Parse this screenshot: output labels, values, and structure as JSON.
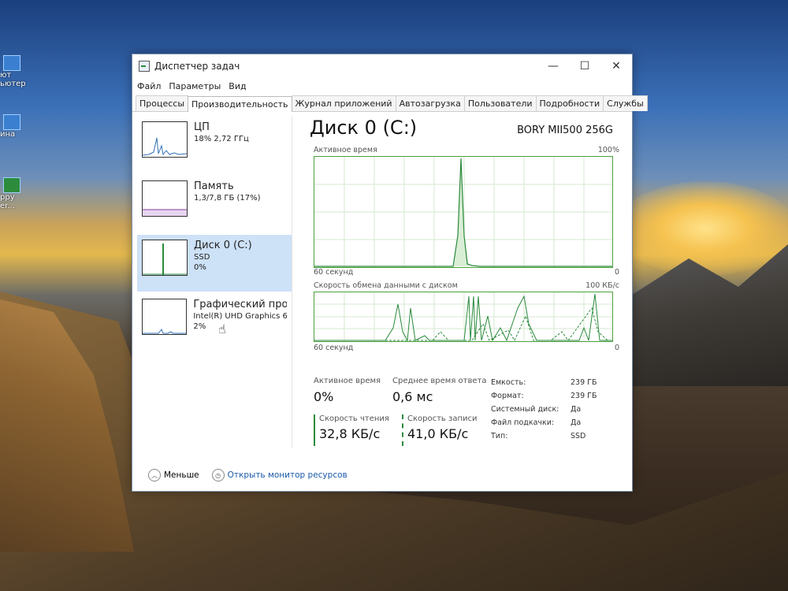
{
  "window": {
    "title": "Диспетчер задач"
  },
  "menu": [
    "Файл",
    "Параметры",
    "Вид"
  ],
  "tabs": [
    "Процессы",
    "Производительность",
    "Журнал приложений",
    "Автозагрузка",
    "Пользователи",
    "Подробности",
    "Службы"
  ],
  "desktop": {
    "icon1": "ьютер",
    "icon1b": "ют",
    "icon2": "ина",
    "icon3": "ppy",
    "icon3b": "er..."
  },
  "sidebar": {
    "items": [
      {
        "name": "ЦП",
        "line1": "18% 2,72 ГГц",
        "line2": ""
      },
      {
        "name": "Память",
        "line1": "1,3/7,8 ГБ (17%)",
        "line2": ""
      },
      {
        "name": "Диск 0 (C:)",
        "line1": "SSD",
        "line2": "0%"
      },
      {
        "name": "Графический про",
        "line1": "Intel(R) UHD Graphics 6",
        "line2": "2%"
      }
    ]
  },
  "main": {
    "title": "Диск 0 (C:)",
    "model": "BORY MII500 256G",
    "graph1": {
      "label": "Активное время",
      "max": "100%",
      "time": "60 секунд",
      "min": "0"
    },
    "graph2": {
      "label": "Скорость обмена данными с диском",
      "max": "100 КБ/с",
      "time": "60 секунд",
      "min": "0"
    },
    "active_time": {
      "label": "Активное время",
      "value": "0%"
    },
    "avg_response": {
      "label": "Среднее время ответа",
      "value": "0,6 мс"
    },
    "read_speed": {
      "label": "Скорость чтения",
      "value": "32,8 КБ/с"
    },
    "write_speed": {
      "label": "Скорость записи",
      "value": "41,0 КБ/с"
    },
    "props": [
      {
        "k": "Емкость:",
        "v": "239 ГБ"
      },
      {
        "k": "Формат:",
        "v": "239 ГБ"
      },
      {
        "k": "Системный диск:",
        "v": "Да"
      },
      {
        "k": "Файл подкачки:",
        "v": "Да"
      },
      {
        "k": "Тип:",
        "v": "SSD"
      }
    ]
  },
  "footer": {
    "less": "Меньше",
    "monitor": "Открыть монитор ресурсов"
  },
  "colors": {
    "accent": "#2a8a3c",
    "selected": "#cde1f7",
    "link": "#1a5aa8"
  }
}
